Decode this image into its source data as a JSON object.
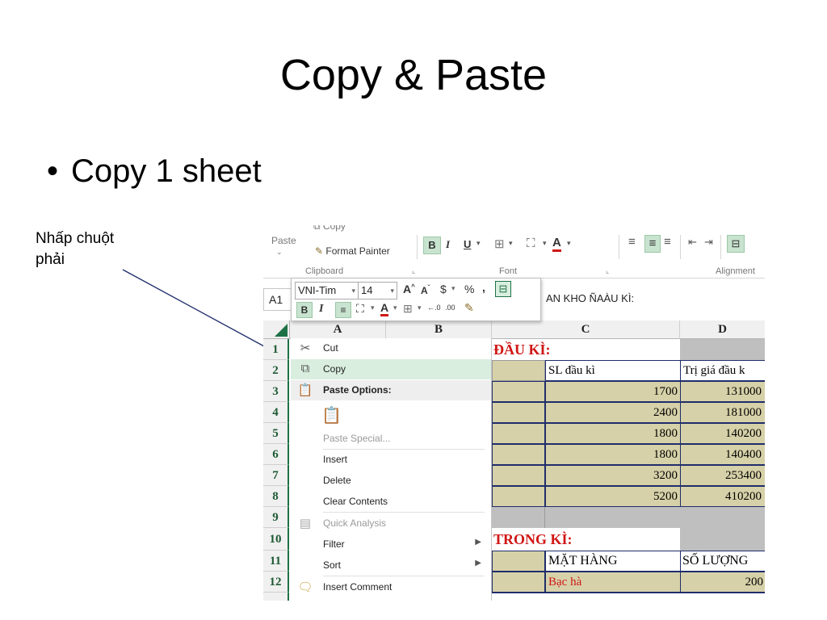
{
  "slide": {
    "title": "Copy & Paste",
    "bullet": "Copy 1 sheet",
    "annotation_line1": "Nhấp chuột",
    "annotation_line2": "phải"
  },
  "ribbon": {
    "paste_label": "Paste",
    "copy_label": "Copy",
    "format_painter_label": "Format Painter",
    "clipboard_group": "Clipboard",
    "font_group": "Font",
    "alignment_group": "Alignment",
    "bold": "B",
    "italic": "I",
    "underline": "U"
  },
  "formula_bar": {
    "name_box": "A1",
    "formula_text": "AN KHO ÑAÀU KÌ:"
  },
  "mini_toolbar": {
    "font_name": "VNI-Tim",
    "font_size": "14",
    "bold": "B",
    "italic": "I",
    "currency": "$",
    "percent": "%",
    "comma": ","
  },
  "columns": [
    "A",
    "B",
    "C",
    "D"
  ],
  "rows": [
    "1",
    "2",
    "3",
    "4",
    "5",
    "6",
    "7",
    "8",
    "9",
    "10",
    "11",
    "12"
  ],
  "context_menu": {
    "cut": "Cut",
    "copy": "Copy",
    "paste_options": "Paste Options:",
    "paste_special": "Paste Special...",
    "insert": "Insert",
    "delete": "Delete",
    "clear_contents": "Clear Contents",
    "quick_analysis": "Quick Analysis",
    "filter": "Filter",
    "sort": "Sort",
    "insert_comment": "Insert Comment"
  },
  "sheet": {
    "dau_ki": "ĐẦU KÌ:",
    "sl_dau_ki": "SL đầu kì",
    "tri_gia": "Trị giá đầu k",
    "c_values": [
      "1700",
      "2400",
      "1800",
      "1800",
      "3200",
      "5200"
    ],
    "d_values": [
      "131000",
      "181000",
      "140200",
      "140400",
      "253400",
      "410200"
    ],
    "trong_ki": "TRONG KÌ:",
    "mat_hang": "MẶT HÀNG",
    "so_luong": "SỐ LƯỢNG",
    "bac_ha": "Bạc hà",
    "d12": "200"
  },
  "colors": {
    "excel_green": "#1e7145",
    "tan_fill": "#d6d1a8",
    "gray_fill": "#bfbfbf",
    "red_text": "#d01616",
    "menu_highlight": "#d9eedf"
  }
}
